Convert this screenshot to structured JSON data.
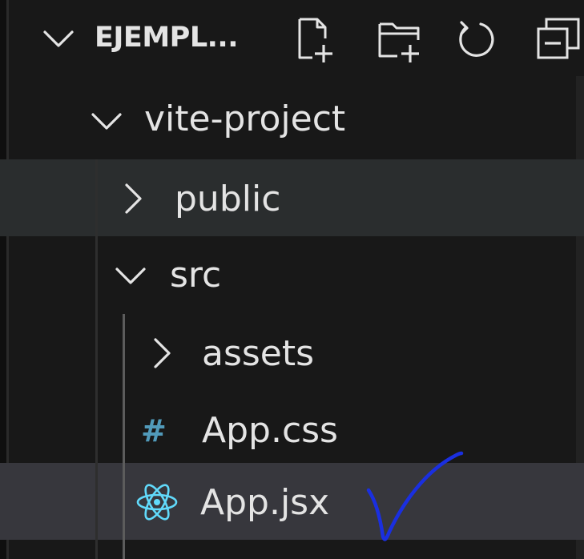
{
  "explorer": {
    "section_title": "EJEMPL...",
    "section_expanded": true,
    "toolbar": {
      "new_file_icon": "new-file-icon",
      "new_folder_icon": "new-folder-icon",
      "refresh_icon": "refresh-icon",
      "collapse_all_icon": "collapse-all-icon"
    },
    "tree": [
      {
        "label": "vite-project",
        "type": "folder",
        "expanded": true,
        "depth": 0
      },
      {
        "label": "public",
        "type": "folder",
        "expanded": false,
        "depth": 1,
        "state": "hover"
      },
      {
        "label": "src",
        "type": "folder",
        "expanded": true,
        "depth": 1
      },
      {
        "label": "assets",
        "type": "folder",
        "expanded": false,
        "depth": 2
      },
      {
        "label": "App.css",
        "type": "file",
        "icon": "css-hash-icon",
        "depth": 2
      },
      {
        "label": "App.jsx",
        "type": "file",
        "icon": "react-icon",
        "depth": 2,
        "state": "selected"
      }
    ],
    "colors": {
      "background": "#181818",
      "hover_row": "#2a2d2e",
      "selected_row": "#37373d",
      "text": "#e4e4e4",
      "css_icon": "#519aba",
      "react_icon": "#61dafb",
      "annotation_ink": "#1a2fe0"
    },
    "annotation": "hand-drawn-checkmark"
  }
}
